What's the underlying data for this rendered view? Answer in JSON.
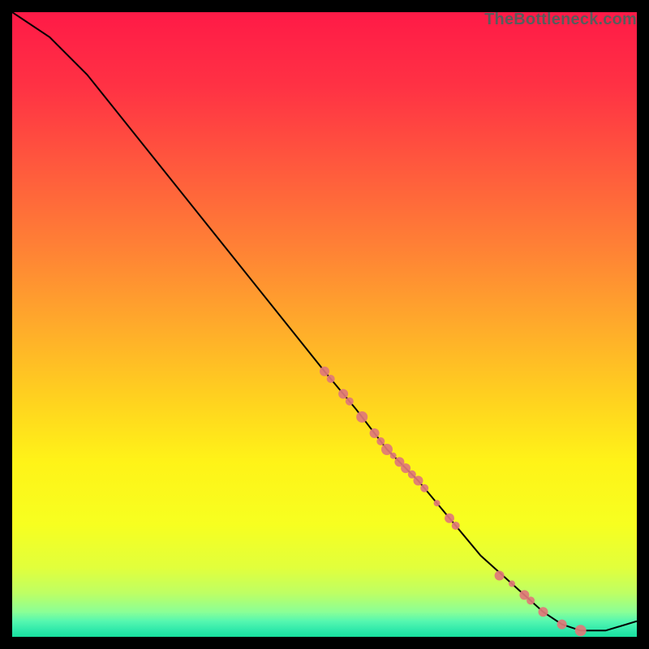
{
  "watermark": "TheBottleneck.com",
  "chart_data": {
    "type": "line",
    "title": "",
    "xlabel": "",
    "ylabel": "",
    "xlim": [
      0,
      100
    ],
    "ylim": [
      0,
      100
    ],
    "grid": false,
    "series": [
      {
        "name": "bottleneck-curve",
        "x": [
          0,
          6,
          12,
          20,
          30,
          40,
          50,
          55,
          60,
          65,
          70,
          75,
          80,
          85,
          88,
          91,
          95,
          100
        ],
        "y": [
          100,
          96,
          90,
          80,
          67.5,
          55,
          42.5,
          36.5,
          30,
          25,
          19,
          13,
          8.5,
          4,
          2,
          1,
          1,
          2.5
        ]
      }
    ],
    "scatter_points": {
      "name": "highlighted-points",
      "color": "#e07878",
      "points": [
        {
          "x": 50,
          "y": 42.5,
          "r": 6
        },
        {
          "x": 51,
          "y": 41.3,
          "r": 5
        },
        {
          "x": 53,
          "y": 38.9,
          "r": 6
        },
        {
          "x": 54,
          "y": 37.7,
          "r": 5
        },
        {
          "x": 56,
          "y": 35.2,
          "r": 7
        },
        {
          "x": 58,
          "y": 32.6,
          "r": 6
        },
        {
          "x": 59,
          "y": 31.3,
          "r": 5
        },
        {
          "x": 60,
          "y": 30.0,
          "r": 7
        },
        {
          "x": 61,
          "y": 29.0,
          "r": 4
        },
        {
          "x": 62,
          "y": 28.0,
          "r": 6
        },
        {
          "x": 63,
          "y": 27.0,
          "r": 6
        },
        {
          "x": 64,
          "y": 26.0,
          "r": 5
        },
        {
          "x": 65,
          "y": 25.0,
          "r": 6
        },
        {
          "x": 66,
          "y": 23.8,
          "r": 5
        },
        {
          "x": 68,
          "y": 21.4,
          "r": 4
        },
        {
          "x": 70,
          "y": 19.0,
          "r": 6
        },
        {
          "x": 71,
          "y": 17.8,
          "r": 5
        },
        {
          "x": 78,
          "y": 9.8,
          "r": 6
        },
        {
          "x": 80,
          "y": 8.5,
          "r": 4
        },
        {
          "x": 82,
          "y": 6.7,
          "r": 6
        },
        {
          "x": 83,
          "y": 5.8,
          "r": 5
        },
        {
          "x": 85,
          "y": 4.0,
          "r": 6
        },
        {
          "x": 88,
          "y": 2.0,
          "r": 6
        },
        {
          "x": 91,
          "y": 1.0,
          "r": 7
        }
      ]
    },
    "background_gradient": {
      "top_color": "#ff1846",
      "stops": [
        {
          "pos": 0.0,
          "color": "#ff1a47"
        },
        {
          "pos": 0.12,
          "color": "#ff3244"
        },
        {
          "pos": 0.25,
          "color": "#ff5a3d"
        },
        {
          "pos": 0.38,
          "color": "#ff8235"
        },
        {
          "pos": 0.5,
          "color": "#ffaa2b"
        },
        {
          "pos": 0.62,
          "color": "#ffd21f"
        },
        {
          "pos": 0.72,
          "color": "#fff318"
        },
        {
          "pos": 0.82,
          "color": "#f7ff20"
        },
        {
          "pos": 0.89,
          "color": "#e1ff3c"
        },
        {
          "pos": 0.93,
          "color": "#beff64"
        },
        {
          "pos": 0.96,
          "color": "#8bff96"
        },
        {
          "pos": 0.975,
          "color": "#55f7b0"
        },
        {
          "pos": 0.99,
          "color": "#2de8aa"
        },
        {
          "pos": 1.0,
          "color": "#18df9e"
        }
      ]
    }
  }
}
